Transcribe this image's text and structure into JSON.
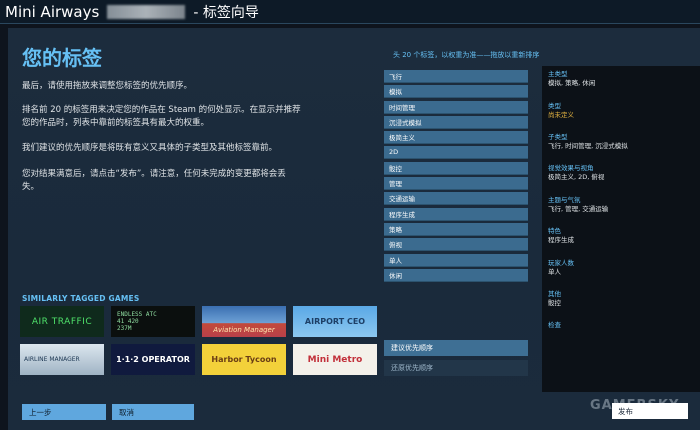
{
  "window": {
    "app_name": "Mini Airways",
    "title_suffix": "- 标签向导"
  },
  "page": {
    "heading": "您的标签",
    "paragraphs": [
      "最后，请使用拖放来调整您标签的优先顺序。",
      "排名前 20 的标签用来决定您的作品在 Steam 的何处显示。在显示并推荐您的作品时，列表中靠前的标签具有最大的权重。",
      "我们建议的优先顺序是将既有意义又具体的子类型及其他标签靠前。",
      "您对结果满意后，请点击“发布”。请注意，任何未完成的变更都将会丢失。"
    ]
  },
  "similar": {
    "title": "SIMILARLY TAGGED GAMES",
    "games": [
      {
        "label": "AIR TRAFFIC"
      },
      {
        "label": "ENDLESS ATC\n41 420\n237M"
      },
      {
        "label": "Aviation Manager"
      },
      {
        "label": "AIRPORT CEO"
      },
      {
        "label": "AIRLINE MANAGER"
      },
      {
        "label": "1·1·2 OPERATOR"
      },
      {
        "label": "Harbor Tycoon"
      },
      {
        "label": "Mini Metro"
      }
    ]
  },
  "buttons": {
    "back": "上一步",
    "cancel": "取消",
    "suggest": "建议优先顺序",
    "restore": "还原优先顺序",
    "publish": "发布"
  },
  "tags": {
    "header": "头 20 个标签，以权重为准——拖放以重新排序",
    "items": [
      "飞行",
      "模拟",
      "时间管理",
      "沉浸式模拟",
      "极简主义",
      "2D",
      "骰控",
      "管理",
      "交通运输",
      "程序生成",
      "策略",
      "俯视",
      "单人",
      "休闲"
    ]
  },
  "categories": [
    {
      "name": "主类型",
      "value": "模拟, 策略, 休闲"
    },
    {
      "name": "类型",
      "value": "尚未定义",
      "warn": true
    },
    {
      "name": "子类型",
      "value": "飞行, 时间管理, 沉浸式模拟"
    },
    {
      "name": "视觉效果与视角",
      "value": "极简主义, 2D, 俯视"
    },
    {
      "name": "主题与气氛",
      "value": "飞行, 管理, 交通运输"
    },
    {
      "name": "特色",
      "value": "程序生成"
    },
    {
      "name": "玩家人数",
      "value": "单人"
    },
    {
      "name": "其他",
      "value": "骰控"
    },
    {
      "name": "检查",
      "value": ""
    }
  ],
  "watermark": "GAMERSKY"
}
